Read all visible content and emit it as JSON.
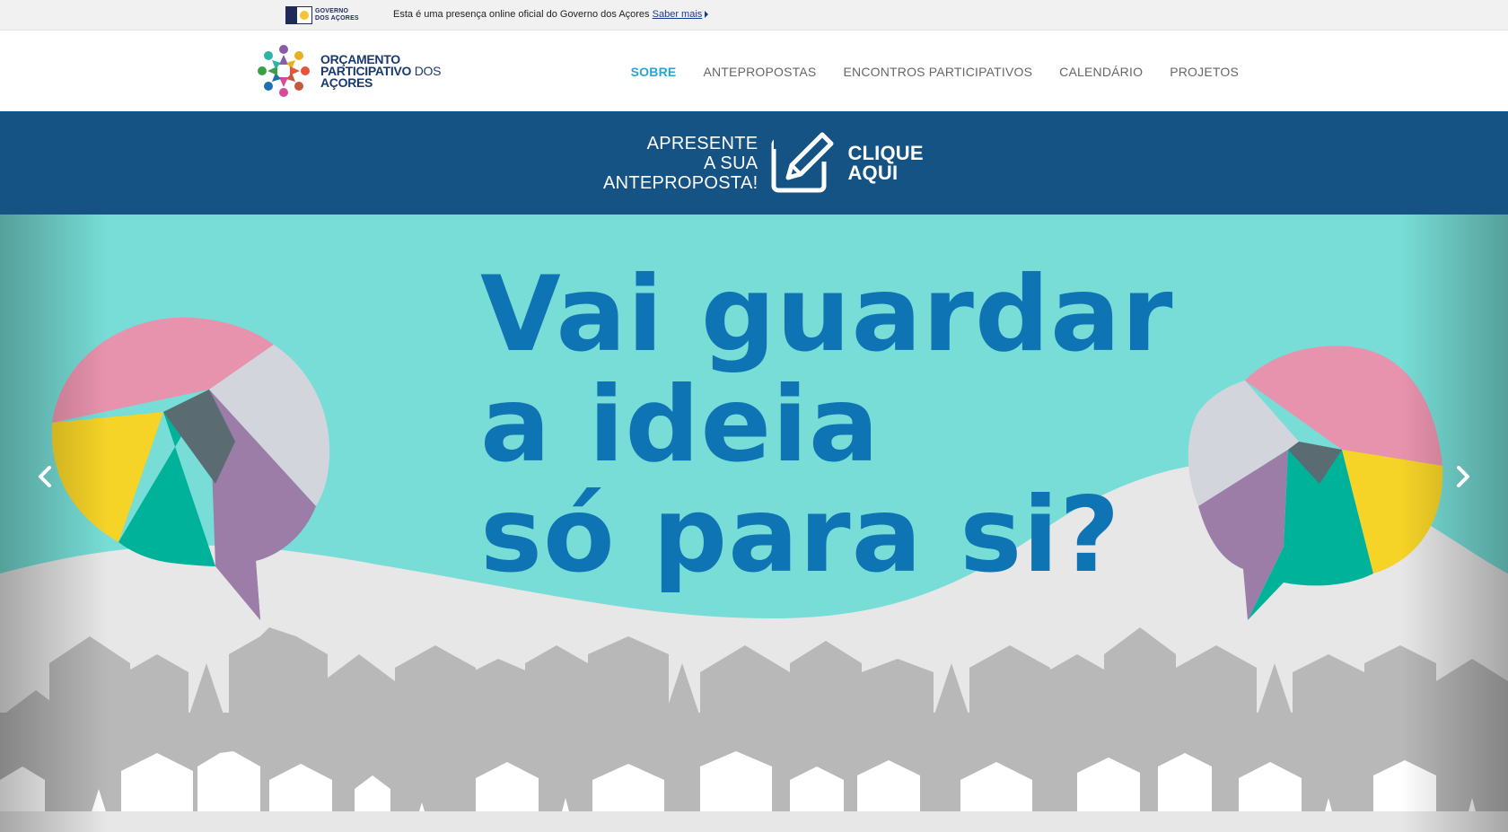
{
  "govbar": {
    "logo_text_line1": "GOVERNO",
    "logo_text_line2": "DOS AÇORES",
    "message": "Esta é uma presença online oficial do Governo dos Açores",
    "link": "Saber mais"
  },
  "brand": {
    "line1": "ORÇAMENTO",
    "line2": "PARTICIPATIVO",
    "line2_suffix": "DOS",
    "line3": "AÇORES"
  },
  "nav": {
    "items": [
      {
        "label": "SOBRE",
        "active": true
      },
      {
        "label": "ANTEPROPOSTAS"
      },
      {
        "label": "ENCONTROS PARTICIPATIVOS"
      },
      {
        "label": "CALENDÁRIO"
      },
      {
        "label": "PROJETOS"
      }
    ]
  },
  "cta": {
    "line1": "APRESENTE",
    "line2": "A SUA",
    "line3": "ANTEPROPOSTA!",
    "button_line1": "CLIQUE",
    "button_line2": "AQUI"
  },
  "hero": {
    "line1": "Vai guardar",
    "line2": "a ideia",
    "line3": "só para si?"
  },
  "colors": {
    "header_bg": "#ffffff",
    "nav_active": "#29a4d4",
    "cta_bg": "#155384",
    "hero_bg": "#77ddd6",
    "headline": "#0e74b3"
  },
  "icons": [
    "governo-acores-logo",
    "op-acores-logo",
    "edit-pencil-icon",
    "chevron-left-icon",
    "chevron-right-icon"
  ]
}
